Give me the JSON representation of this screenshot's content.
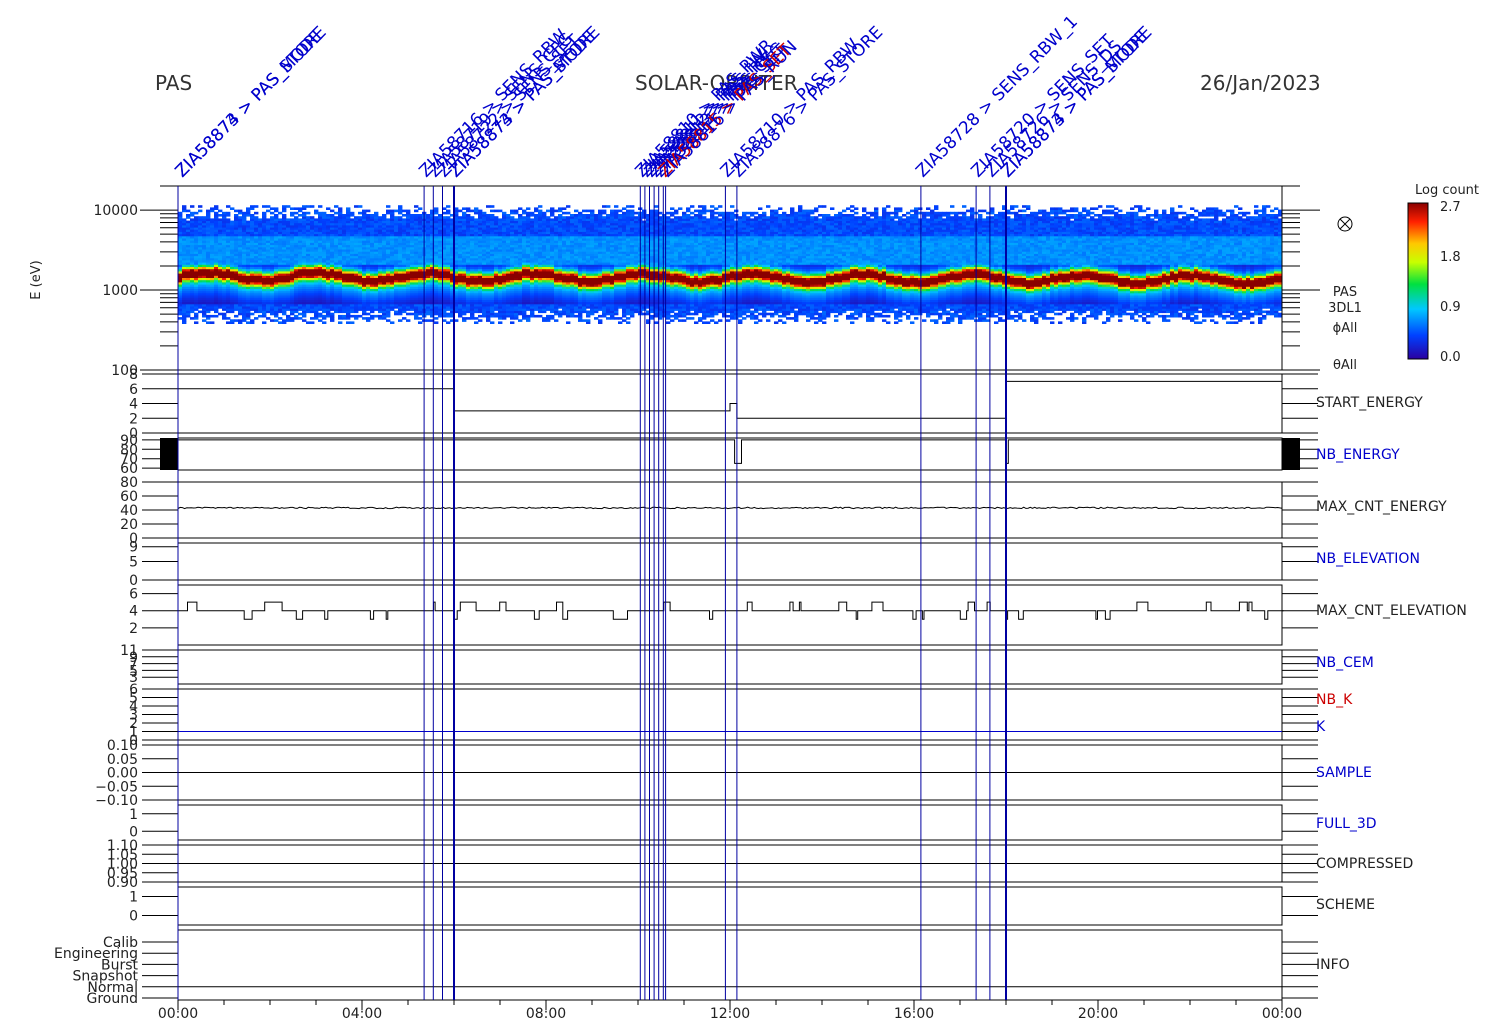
{
  "header": {
    "instrument": "PAS",
    "mission": "SOLAR-ORBITER",
    "date": "26/Jan/2023"
  },
  "colors": {
    "frame": "#000000",
    "event_line": "#0000a0",
    "command_label": "#0000cc",
    "command_label_alt": "#cc0000",
    "name_black": "#000000",
    "name_blue": "#0000cc",
    "name_red": "#cc0000"
  },
  "command_labels": [
    {
      "t": 0.05,
      "text": "ZIA58873 > PAS_STORE"
    },
    {
      "t": 0.05,
      "text": "ZIA58874 > PAS_MODE"
    },
    {
      "t": 5.35,
      "text": "ZIA58716 > SENS_RBW"
    },
    {
      "t": 5.55,
      "text": "ZIA58719 > SENS_CFG"
    },
    {
      "t": 5.75,
      "text": "ZIA58722 > SENS_SET"
    },
    {
      "t": 6.0,
      "text": "ZIA58873 > PAS_STORE"
    },
    {
      "t": 6.0,
      "text": "ZIA58874 > PAS_MODE"
    },
    {
      "t": 10.05,
      "text": "ZIA58810 > PAS_PWR"
    },
    {
      "t": 10.15,
      "text": "ZIA58811 > PAS_HV"
    },
    {
      "t": 10.25,
      "text": "ZIA58812 > PAS_HV"
    },
    {
      "t": 10.35,
      "text": "ZIA58813 > PAS_CFG"
    },
    {
      "t": 10.45,
      "text": "ZIA58814 > PAS_SET"
    },
    {
      "t": 10.55,
      "text": "ZIA58815 > PAS_SET"
    },
    {
      "t": 10.6,
      "text": "ZIA58816 > PAS_RUN"
    },
    {
      "t": 11.9,
      "text": "ZIA58710 > PAS_RBW"
    },
    {
      "t": 12.15,
      "text": "ZIA58876 > PAS_STORE"
    },
    {
      "t": 16.15,
      "text": "ZIA58728 > SENS_RBW_1"
    },
    {
      "t": 17.35,
      "text": "ZIA58720 > SENS_SET"
    },
    {
      "t": 17.65,
      "text": "ZIA58726 > SENS_DS"
    },
    {
      "t": 18.0,
      "text": "ZIA58873 > PAS_STORE"
    },
    {
      "t": 18.0,
      "text": "ZIA58874 > PAS_MODE"
    }
  ],
  "panel_names": {
    "spectrogram": [
      "PAS",
      "3DL1",
      "ϕAll",
      "θAll"
    ],
    "start_energy": "START_ENERGY",
    "nb_energy": "NB_ENERGY",
    "max_cnt_energy": "MAX_CNT_ENERGY",
    "nb_elevation": "NB_ELEVATION",
    "max_cnt_elevation": "MAX_CNT_ELEVATION",
    "nb_cem": "NB_CEM",
    "nb_k": "NB_K",
    "k": "K",
    "sample": "SAMPLE",
    "full_3d": "FULL_3D",
    "compressed": "COMPRESSED",
    "scheme": "SCHEME",
    "info": "INFO"
  },
  "colorbar": {
    "title": "Log count",
    "ticks": [
      "2.7",
      "1.8",
      "0.9",
      "0.0"
    ]
  },
  "chart_data": {
    "type": "line",
    "x_axis": {
      "unit": "hours UT",
      "range": [
        0,
        24
      ],
      "ticks": [
        "00:00",
        "04:00",
        "08:00",
        "12:00",
        "16:00",
        "20:00",
        "00:00"
      ]
    },
    "spectrogram": {
      "type": "heatmap",
      "ylabel": "E (eV)",
      "yscale": "log",
      "ylim": [
        100,
        20000
      ],
      "ytick_labels": [
        "10000",
        "1000",
        "100"
      ],
      "peak_energy_ev": 1500,
      "data_energy_range_ev": [
        380,
        11500
      ],
      "colorscale_range": [
        0.0,
        2.7
      ]
    },
    "panels": [
      {
        "id": "start_energy",
        "ylim": [
          0,
          8
        ],
        "ytick_labels": [
          "8",
          "6",
          "4",
          "2",
          "0"
        ],
        "series": [
          {
            "x": [
              0,
              0.02,
              6.0,
              6.0,
              12.0,
              12.0,
              12.15,
              12.15,
              18.0,
              18.0,
              24
            ],
            "y": [
              6,
              6,
              6,
              3,
              3,
              4,
              4,
              2,
              2,
              7,
              7
            ]
          }
        ]
      },
      {
        "id": "nb_energy",
        "ylim": [
          58,
          92
        ],
        "ytick_labels": [
          "90",
          "80",
          "70",
          "60"
        ],
        "series": [
          {
            "x": [
              0,
              12.1,
              12.1,
              12.25,
              12.25,
              18.0,
              18.0,
              18.05,
              18.05,
              24
            ],
            "y": [
              90,
              90,
              65,
              65,
              90,
              90,
              65,
              65,
              90,
              90
            ]
          }
        ]
      },
      {
        "id": "max_cnt_energy",
        "ylim": [
          0,
          80
        ],
        "ytick_labels": [
          "80",
          "60",
          "40",
          "20",
          "0"
        ],
        "baseline": 0,
        "series": [
          {
            "mean": 43,
            "noise": 2
          }
        ]
      },
      {
        "id": "nb_elevation",
        "ylim": [
          0,
          10
        ],
        "ytick_labels": [
          "9",
          "5",
          "0"
        ],
        "series": []
      },
      {
        "id": "max_cnt_elevation",
        "ylim": [
          0,
          7
        ],
        "ytick_labels": [
          "6",
          "4",
          "2"
        ],
        "series": [
          {
            "levels": [
              3,
              4,
              5
            ],
            "dominant": 4
          }
        ]
      },
      {
        "id": "nb_cem",
        "ylim": [
          1,
          11
        ],
        "ytick_labels": [
          "11",
          "9",
          "7",
          "5",
          "3"
        ],
        "series": []
      },
      {
        "id": "nb_k",
        "ylim": [
          0,
          6
        ],
        "ytick_labels": [
          "6",
          "5",
          "4",
          "3",
          "2",
          "1",
          "0"
        ],
        "baseline": 0,
        "series": [
          {
            "name": "NB_K",
            "y_const": 1
          },
          {
            "name": "K",
            "y_const": 1
          }
        ]
      },
      {
        "id": "sample",
        "ylim": [
          -0.1,
          0.1
        ],
        "ytick_labels": [
          "0.10",
          "0.05",
          "0.00",
          "−0.05",
          "−0.10"
        ],
        "series": [
          {
            "y_const": 0
          }
        ]
      },
      {
        "id": "full_3d",
        "ylim": [
          -0.5,
          1.5
        ],
        "ytick_labels": [
          "1",
          "0"
        ],
        "series": []
      },
      {
        "id": "compressed",
        "ylim": [
          0.9,
          1.1
        ],
        "ytick_labels": [
          "1.10",
          "1.05",
          "1.00",
          "0.95",
          "0.90"
        ],
        "series": [
          {
            "y_const": 1.0
          }
        ]
      },
      {
        "id": "scheme",
        "ylim": [
          -0.5,
          1.5
        ],
        "ytick_labels": [
          "1",
          "0"
        ],
        "series": []
      },
      {
        "id": "info",
        "ytick_labels": [
          "Calib",
          "Engineering",
          "Burst",
          "Snapshot",
          "Normal",
          "Ground"
        ],
        "series": [
          {
            "y_const": "Normal"
          }
        ]
      }
    ],
    "event_times": [
      5.35,
      5.55,
      5.75,
      6.0,
      10.05,
      10.15,
      10.25,
      10.35,
      10.45,
      10.55,
      10.6,
      11.9,
      12.15,
      16.15,
      17.35,
      17.65,
      18.0
    ]
  }
}
